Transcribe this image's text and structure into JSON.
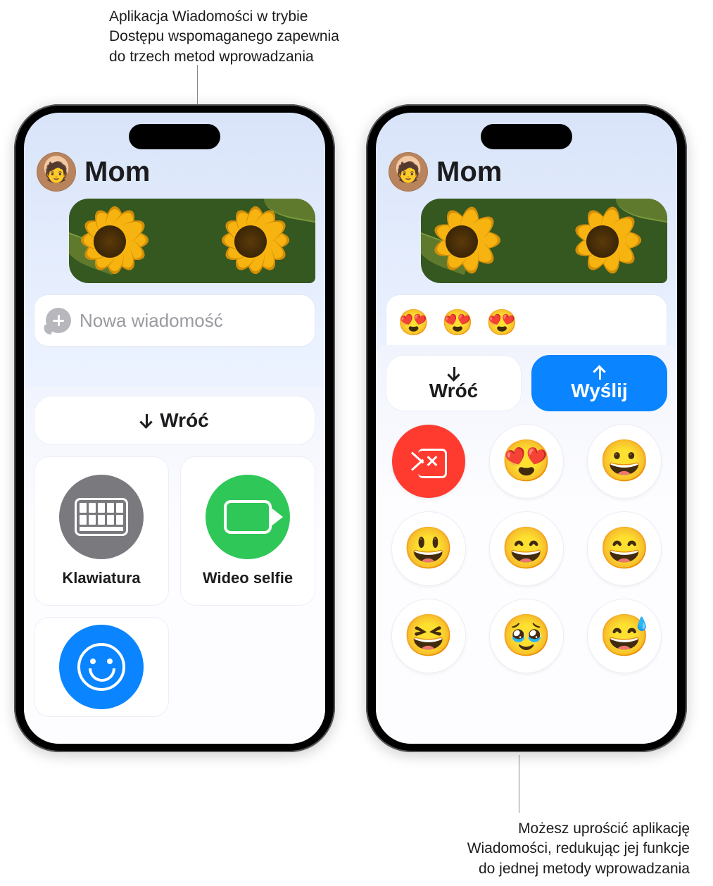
{
  "annotations": {
    "top": "Aplikacja Wiadomości w trybie\nDostępu wspomaganego zapewnia\ndo trzech metod wprowadzania",
    "bottom": "Możesz uprościć aplikację\nWiadomości, redukując jej funkcje\ndo jednej metody wprowadzania"
  },
  "leftPhone": {
    "contactName": "Mom",
    "inputPlaceholder": "Nowa wiadomość",
    "backButton": "Wróć",
    "tiles": {
      "keyboard": "Klawiatura",
      "videoSelfie": "Wideo selfie"
    }
  },
  "rightPhone": {
    "contactName": "Mom",
    "composedMessage": "😍 😍 😍",
    "backButton": "Wróć",
    "sendButton": "Wyślij",
    "emojiKeys": [
      "😍",
      "😀",
      "😃",
      "😄",
      "😄",
      "😆",
      "🥹",
      "😅"
    ]
  }
}
